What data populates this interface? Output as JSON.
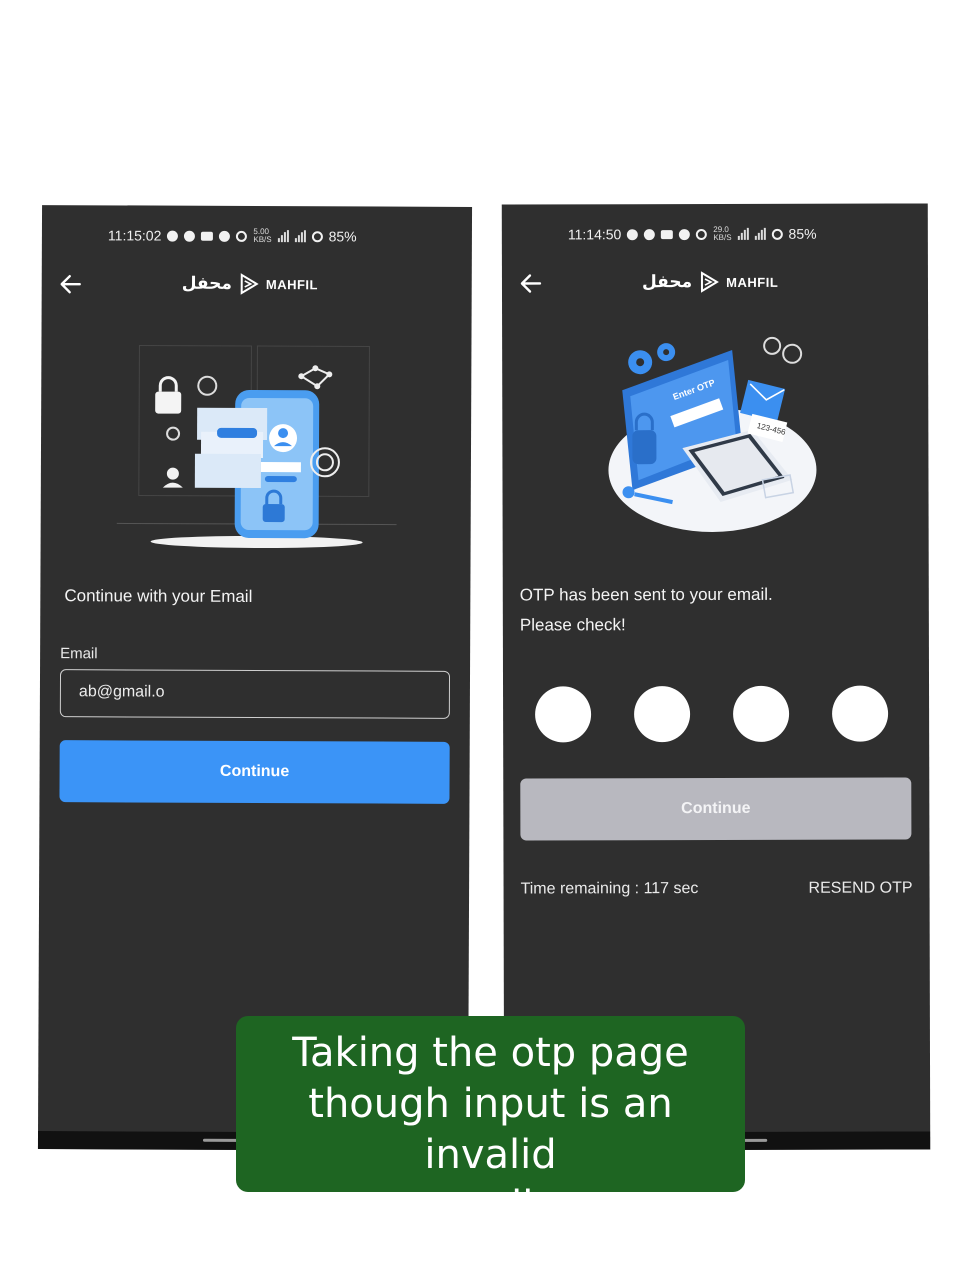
{
  "left_screen": {
    "status_time": "11:15:02",
    "net_speed": "5.00",
    "net_unit": "KB/S",
    "battery": "85%",
    "brand_arabic": "محفل",
    "brand_name": "MAHFIL",
    "heading": "Continue with your Email",
    "email_label": "Email",
    "email_value": "ab@gmail.o",
    "continue_label": "Continue"
  },
  "right_screen": {
    "status_time": "11:14:50",
    "net_speed": "29.0",
    "net_unit": "KB/S",
    "battery": "85%",
    "brand_arabic": "محفل",
    "brand_name": "MAHFIL",
    "heading_line1": "OTP has been sent to your email.",
    "heading_line2": "Please check!",
    "continue_label": "Continue",
    "time_remaining": "Time remaining : 117 sec",
    "resend_label": "RESEND OTP",
    "illustration_otp_text": "Enter OTP",
    "illustration_code": "123-456"
  },
  "caption": {
    "line1": "Taking the otp page",
    "line2": "though input is an invalid",
    "line3": "mail"
  },
  "colors": {
    "screen_bg": "#2f2f2f",
    "primary_button": "#3b94f7",
    "disabled_button": "#b8b8bf",
    "caption_bg": "#1e6522"
  }
}
